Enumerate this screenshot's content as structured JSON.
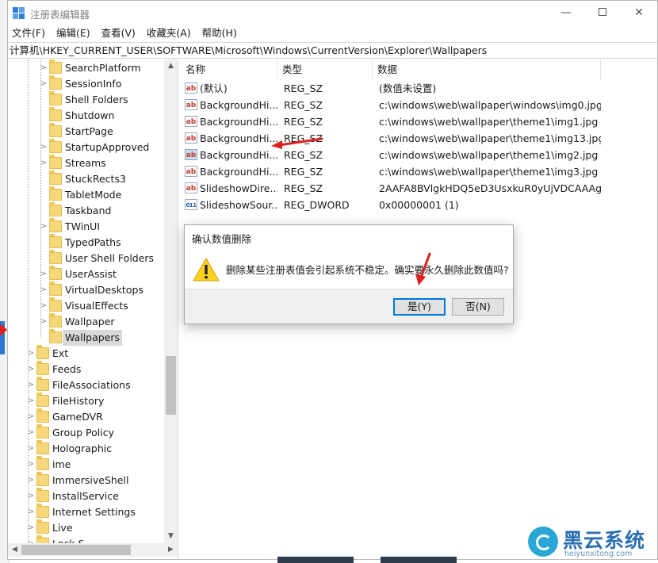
{
  "window": {
    "title": "注册表编辑器",
    "minimize": "—",
    "close": "✕"
  },
  "menu": [
    "文件(F)",
    "编辑(E)",
    "查看(V)",
    "收藏夹(A)",
    "帮助(H)"
  ],
  "address": "计算机\\HKEY_CURRENT_USER\\SOFTWARE\\Microsoft\\Windows\\CurrentVersion\\Explorer\\Wallpapers",
  "tree": {
    "children": [
      {
        "label": "SearchPlatform",
        "expandable": true
      },
      {
        "label": "SessionInfo",
        "expandable": true
      },
      {
        "label": "Shell Folders",
        "expandable": false
      },
      {
        "label": "Shutdown",
        "expandable": false
      },
      {
        "label": "StartPage",
        "expandable": false
      },
      {
        "label": "StartupApproved",
        "expandable": true
      },
      {
        "label": "Streams",
        "expandable": true
      },
      {
        "label": "StuckRects3",
        "expandable": false
      },
      {
        "label": "TabletMode",
        "expandable": false
      },
      {
        "label": "Taskband",
        "expandable": false
      },
      {
        "label": "TWinUI",
        "expandable": true
      },
      {
        "label": "TypedPaths",
        "expandable": false
      },
      {
        "label": "User Shell Folders",
        "expandable": false
      },
      {
        "label": "UserAssist",
        "expandable": true
      },
      {
        "label": "VirtualDesktops",
        "expandable": true
      },
      {
        "label": "VisualEffects",
        "expandable": true
      },
      {
        "label": "Wallpaper",
        "expandable": true
      },
      {
        "label": "Wallpapers",
        "expandable": false,
        "selected": true
      }
    ],
    "siblings": [
      {
        "label": "Ext"
      },
      {
        "label": "Feeds"
      },
      {
        "label": "FileAssociations"
      },
      {
        "label": "FileHistory"
      },
      {
        "label": "GameDVR"
      },
      {
        "label": "Group Policy"
      },
      {
        "label": "Holographic"
      },
      {
        "label": "ime"
      },
      {
        "label": "ImmersiveShell"
      },
      {
        "label": "InstallService"
      },
      {
        "label": "Internet Settings"
      },
      {
        "label": "Live"
      },
      {
        "label": "Lock S"
      }
    ]
  },
  "list": {
    "columns": [
      "名称",
      "类型",
      "数据"
    ],
    "rows": [
      {
        "icon": "ab",
        "name": "(默认)",
        "type": "REG_SZ",
        "data": "(数值未设置)"
      },
      {
        "icon": "ab",
        "name": "BackgroundHi...",
        "type": "REG_SZ",
        "data": "c:\\windows\\web\\wallpaper\\windows\\img0.jpg"
      },
      {
        "icon": "ab",
        "name": "BackgroundHi...",
        "type": "REG_SZ",
        "data": "c:\\windows\\web\\wallpaper\\theme1\\img1.jpg"
      },
      {
        "icon": "ab",
        "name": "BackgroundHi...",
        "type": "REG_SZ",
        "data": "c:\\windows\\web\\wallpaper\\theme1\\img13.jpg"
      },
      {
        "icon": "ab",
        "name": "BackgroundHi...",
        "type": "REG_SZ",
        "data": "c:\\windows\\web\\wallpaper\\theme1\\img2.jpg",
        "selected": true
      },
      {
        "icon": "ab",
        "name": "BackgroundHi...",
        "type": "REG_SZ",
        "data": "c:\\windows\\web\\wallpaper\\theme1\\img3.jpg"
      },
      {
        "icon": "ab",
        "name": "SlideshowDire...",
        "type": "REG_SZ",
        "data": "2AAFA8BVlgkHDQ5eD3UsxkuR0yUjVDCAAAg..."
      },
      {
        "icon": "bin",
        "name": "SlideshowSour...",
        "type": "REG_DWORD",
        "data": "0x00000001 (1)"
      }
    ]
  },
  "dialog": {
    "title": "确认数值删除",
    "message": "删除某些注册表值会引起系统不稳定。确实要永久删除此数值吗?",
    "yes": "是(Y)",
    "no": "否(N)"
  },
  "watermark": {
    "brand": "黑云系统",
    "url": "heiyunxitong.com"
  },
  "colors": {
    "accent": "#0078d7",
    "arrow": "#e02020",
    "folder": "#f6d77a"
  }
}
